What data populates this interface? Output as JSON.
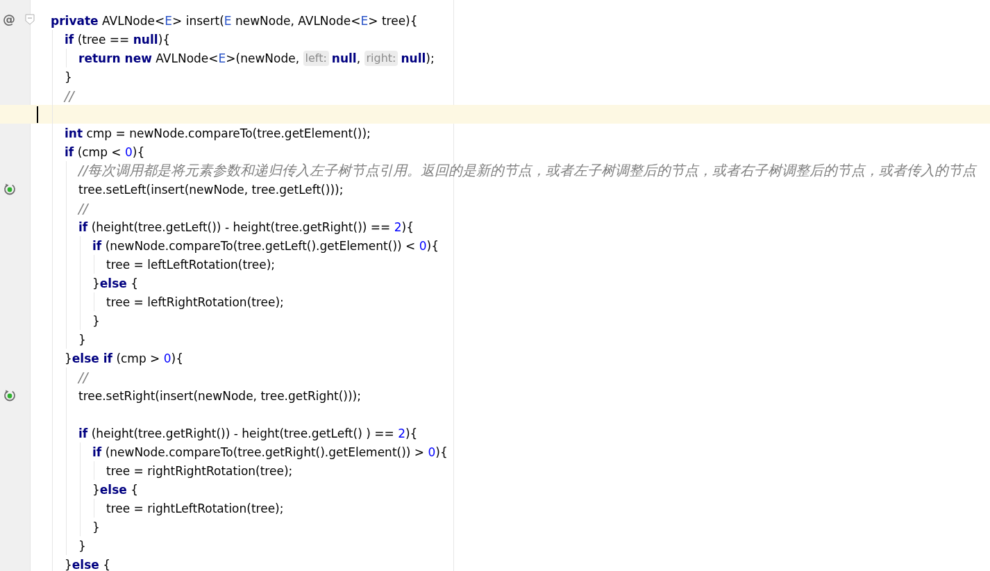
{
  "lines": [
    {
      "gutter_text": "@",
      "foldable": true,
      "current": false,
      "tokens": [
        {
          "kind": "keyword",
          "text": "private"
        },
        {
          "kind": "plain",
          "text": " AVLNode<"
        },
        {
          "kind": "type_param",
          "text": "E"
        },
        {
          "kind": "plain",
          "text": "> insert("
        },
        {
          "kind": "type_param",
          "text": "E"
        },
        {
          "kind": "plain",
          "text": " newNode, AVLNode<"
        },
        {
          "kind": "type_param",
          "text": "E"
        },
        {
          "kind": "plain",
          "text": "> tree){"
        }
      ],
      "children": [
        {
          "current": false,
          "tokens": [
            {
              "kind": "keyword",
              "text": "if"
            },
            {
              "kind": "plain",
              "text": " (tree == "
            },
            {
              "kind": "keyword",
              "text": "null"
            },
            {
              "kind": "plain",
              "text": "){"
            }
          ],
          "children": [
            {
              "current": false,
              "tokens": [
                {
                  "kind": "keyword",
                  "text": "return new"
                },
                {
                  "kind": "plain",
                  "text": " AVLNode<"
                },
                {
                  "kind": "type_param",
                  "text": "E"
                },
                {
                  "kind": "plain",
                  "text": ">(newNode, "
                },
                {
                  "kind": "hint",
                  "text": "left:"
                },
                {
                  "kind": "keyword",
                  "text": "null"
                },
                {
                  "kind": "plain",
                  "text": ", "
                },
                {
                  "kind": "hint",
                  "text": "right:"
                },
                {
                  "kind": "keyword",
                  "text": "null"
                },
                {
                  "kind": "plain",
                  "text": ");"
                }
              ]
            }
          ]
        },
        {
          "current": false,
          "tokens": [
            {
              "kind": "plain",
              "text": "}"
            }
          ]
        },
        {
          "current": false,
          "tokens": [
            {
              "kind": "comment",
              "text": "//"
            }
          ]
        },
        {
          "current": true
        },
        {
          "current": false,
          "tokens": [
            {
              "kind": "keyword",
              "text": "int"
            },
            {
              "kind": "plain",
              "text": " cmp = newNode.compareTo(tree.getElement());"
            }
          ]
        },
        {
          "current": false,
          "tokens": [
            {
              "kind": "keyword",
              "text": "if"
            },
            {
              "kind": "plain",
              "text": " (cmp < "
            },
            {
              "kind": "number",
              "text": "0"
            },
            {
              "kind": "plain",
              "text": "){"
            }
          ],
          "children": [
            {
              "current": false,
              "tokens": [
                {
                  "kind": "comment",
                  "text": "//每次调用都是将元素参数和递归传入左子树节点引用。返回的是新的节点，或者左子树调整后的节点，或者右子树调整后的节点，或者传入的节点"
                }
              ]
            },
            {
              "recursive_call": true,
              "current": false,
              "tokens": [
                {
                  "kind": "plain",
                  "text": "tree.setLeft(insert(newNode, tree.getLeft()));"
                }
              ]
            },
            {
              "current": false,
              "tokens": [
                {
                  "kind": "comment",
                  "text": "//"
                }
              ]
            },
            {
              "current": false,
              "tokens": [
                {
                  "kind": "keyword",
                  "text": "if"
                },
                {
                  "kind": "plain",
                  "text": " (height(tree.getLeft()) - height(tree.getRight()) == "
                },
                {
                  "kind": "number",
                  "text": "2"
                },
                {
                  "kind": "plain",
                  "text": "){"
                }
              ],
              "children": [
                {
                  "current": false,
                  "tokens": [
                    {
                      "kind": "keyword",
                      "text": "if"
                    },
                    {
                      "kind": "plain",
                      "text": " (newNode.compareTo(tree.getLeft().getElement()) < "
                    },
                    {
                      "kind": "number",
                      "text": "0"
                    },
                    {
                      "kind": "plain",
                      "text": "){"
                    }
                  ],
                  "children": [
                    {
                      "current": false,
                      "tokens": [
                        {
                          "kind": "plain",
                          "text": "tree = leftLeftRotation(tree);"
                        }
                      ]
                    }
                  ]
                },
                {
                  "current": false,
                  "tokens": [
                    {
                      "kind": "plain",
                      "text": "}"
                    },
                    {
                      "kind": "keyword",
                      "text": "else"
                    },
                    {
                      "kind": "plain",
                      "text": " {"
                    }
                  ],
                  "children": [
                    {
                      "current": false,
                      "tokens": [
                        {
                          "kind": "plain",
                          "text": "tree = leftRightRotation(tree);"
                        }
                      ]
                    }
                  ]
                },
                {
                  "current": false,
                  "tokens": [
                    {
                      "kind": "plain",
                      "text": "}"
                    }
                  ]
                }
              ]
            },
            {
              "current": false,
              "tokens": [
                {
                  "kind": "plain",
                  "text": "}"
                }
              ]
            }
          ]
        },
        {
          "current": false,
          "tokens": [
            {
              "kind": "plain",
              "text": "}"
            },
            {
              "kind": "keyword",
              "text": "else if"
            },
            {
              "kind": "plain",
              "text": " (cmp > "
            },
            {
              "kind": "number",
              "text": "0"
            },
            {
              "kind": "plain",
              "text": "){"
            }
          ],
          "children": [
            {
              "current": false,
              "tokens": [
                {
                  "kind": "comment",
                  "text": "//"
                }
              ]
            },
            {
              "recursive_call": true,
              "current": false,
              "tokens": [
                {
                  "kind": "plain",
                  "text": "tree.setRight(insert(newNode, tree.getRight()));"
                }
              ]
            },
            {
              "current": false
            },
            {
              "current": false,
              "tokens": [
                {
                  "kind": "keyword",
                  "text": "if"
                },
                {
                  "kind": "plain",
                  "text": " (height(tree.getRight()) - height(tree.getLeft() ) == "
                },
                {
                  "kind": "number",
                  "text": "2"
                },
                {
                  "kind": "plain",
                  "text": "){"
                }
              ],
              "children": [
                {
                  "current": false,
                  "tokens": [
                    {
                      "kind": "keyword",
                      "text": "if"
                    },
                    {
                      "kind": "plain",
                      "text": " (newNode.compareTo(tree.getRight().getElement()) > "
                    },
                    {
                      "kind": "number",
                      "text": "0"
                    },
                    {
                      "kind": "plain",
                      "text": "){"
                    }
                  ],
                  "children": [
                    {
                      "current": false,
                      "tokens": [
                        {
                          "kind": "plain",
                          "text": "tree = rightRightRotation(tree);"
                        }
                      ]
                    }
                  ]
                },
                {
                  "current": false,
                  "tokens": [
                    {
                      "kind": "plain",
                      "text": "}"
                    },
                    {
                      "kind": "keyword",
                      "text": "else"
                    },
                    {
                      "kind": "plain",
                      "text": " {"
                    }
                  ],
                  "children": [
                    {
                      "current": false,
                      "tokens": [
                        {
                          "kind": "plain",
                          "text": "tree = rightLeftRotation(tree);"
                        }
                      ]
                    }
                  ]
                },
                {
                  "current": false,
                  "tokens": [
                    {
                      "kind": "plain",
                      "text": "}"
                    }
                  ]
                }
              ]
            },
            {
              "current": false,
              "tokens": [
                {
                  "kind": "plain",
                  "text": "}"
                }
              ]
            }
          ]
        },
        {
          "current": false,
          "tokens": [
            {
              "kind": "plain",
              "text": "}"
            },
            {
              "kind": "keyword",
              "text": "else"
            },
            {
              "kind": "plain",
              "text": " {"
            }
          ]
        }
      ]
    }
  ]
}
